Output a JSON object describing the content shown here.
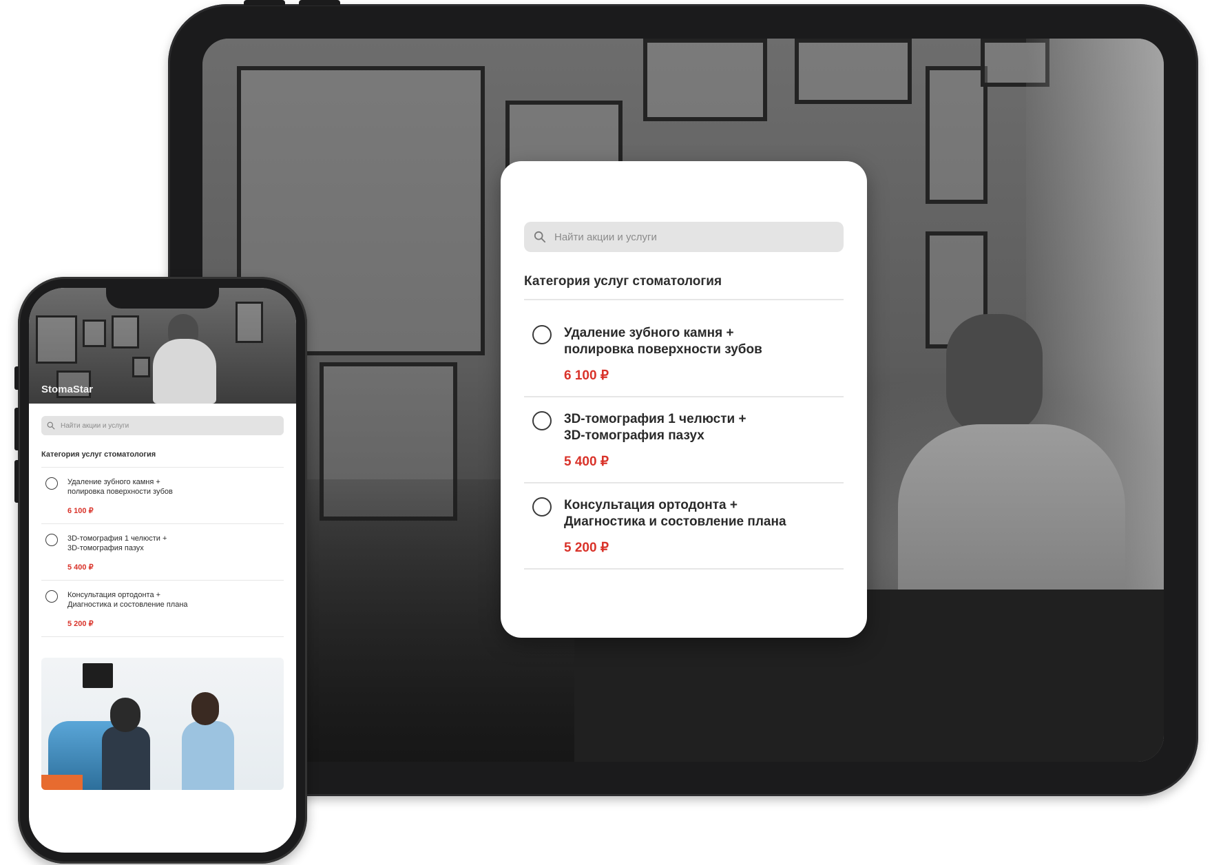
{
  "tablet": {
    "modal": {
      "search_placeholder": "Найти акции и услуги",
      "category_title": "Категория услуг стоматология",
      "services": [
        {
          "title": "Удаление зубного камня +",
          "title2": "полировка поверхности зубов",
          "price": "6 100 ₽"
        },
        {
          "title": "3D-томография 1 челюсти +",
          "title2": "3D-томография пазух",
          "price": "5 400 ₽"
        },
        {
          "title": "Консультация ортодонта +",
          "title2": "Диагностика и состовление плана",
          "price": "5 200 ₽"
        }
      ]
    }
  },
  "phone": {
    "hero": {
      "brand": "StomaStar"
    },
    "search_placeholder": "Найти акции и услуги",
    "category_title": "Категория услуг стоматология",
    "services": [
      {
        "title": "Удаление зубного камня +",
        "title2": "полировка поверхности зубов",
        "price": "6 100 ₽"
      },
      {
        "title": "3D-томография 1 челюсти +",
        "title2": "3D-томография пазух",
        "price": "5 400 ₽"
      },
      {
        "title": "Консультация ортодонта +",
        "title2": "Диагностика и состовление плана",
        "price": "5 200 ₽"
      }
    ]
  },
  "colors": {
    "price": "#d9332a",
    "search_bg": "#e4e4e4",
    "device_frame": "#1b1b1c"
  },
  "icons": {
    "search": "search-icon",
    "radio": "radio-unselected-icon"
  }
}
